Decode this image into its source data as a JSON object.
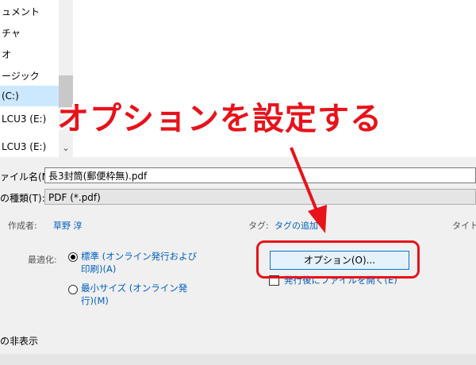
{
  "nav": {
    "items": [
      "ュメント",
      "チャ",
      "オ",
      "ージック",
      "(C:)",
      "LCU3 (E:)",
      "LCU3 (E:)"
    ],
    "scroll_down_glyph": "⌄"
  },
  "form": {
    "filename_label": "ァイル名(N):",
    "filename_value": "長3封筒(郵便枠無).pdf",
    "filetype_label": "の種類(T):",
    "filetype_value": "PDF (*.pdf)"
  },
  "meta": {
    "author_label": "作成者:",
    "author_value": "草野 淳",
    "tags_label": "タグ:",
    "tags_value": "タグの追加",
    "title_label": "タイト"
  },
  "optimize": {
    "label": "最適化:",
    "option1": "標準 (オンライン発行および印刷)(A)",
    "option2": "最小サイズ (オンライン発行)(M)"
  },
  "options_button": "オプション(O)...",
  "open_after_publish": "発行後にファイルを開く(E)",
  "hide_folders": "の非表示",
  "callout_text": "オプションを設定する",
  "colors": {
    "annotation_red": "#e8121a",
    "link_blue": "#0060c0",
    "selection": "#cce8ff"
  }
}
